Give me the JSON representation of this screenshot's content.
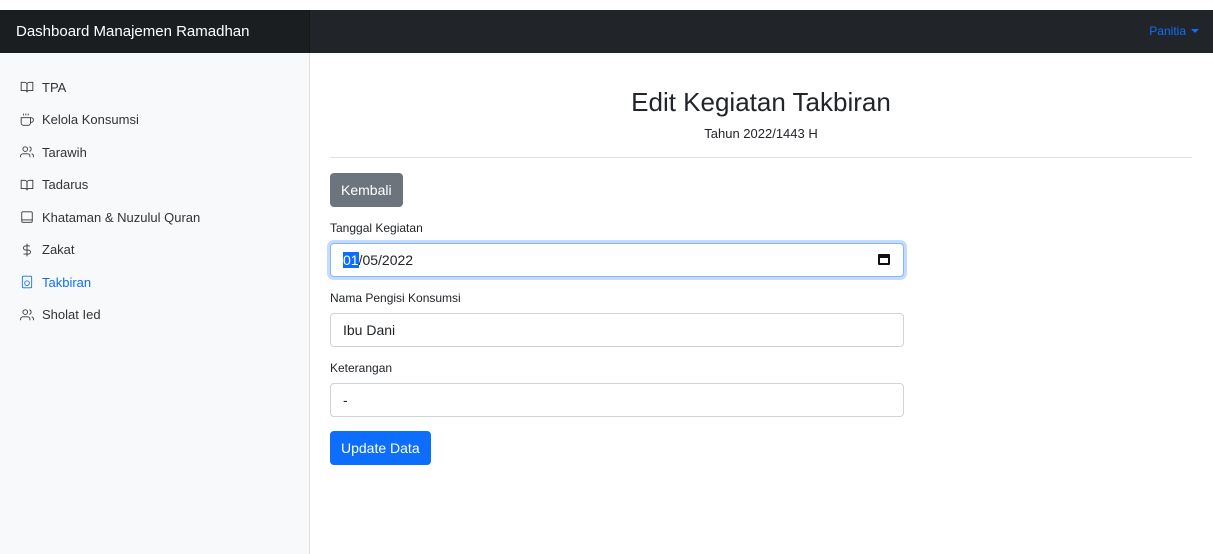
{
  "header": {
    "brand": "Dashboard Manajemen Ramadhan",
    "user_menu_label": "Panitia"
  },
  "sidebar": {
    "items": [
      {
        "label": "TPA",
        "icon": "book-open-icon",
        "active": false
      },
      {
        "label": "Kelola Konsumsi",
        "icon": "coffee-icon",
        "active": false
      },
      {
        "label": "Tarawih",
        "icon": "users-icon",
        "active": false
      },
      {
        "label": "Tadarus",
        "icon": "book-open-icon",
        "active": false
      },
      {
        "label": "Khataman & Nuzulul Quran",
        "icon": "square-icon",
        "active": false
      },
      {
        "label": "Zakat",
        "icon": "dollar-sign-icon",
        "active": false
      },
      {
        "label": "Takbiran",
        "icon": "speaker-icon",
        "active": true
      },
      {
        "label": "Sholat Ied",
        "icon": "users-icon",
        "active": false
      }
    ]
  },
  "main": {
    "title": "Edit Kegiatan Takbiran",
    "subtitle": "Tahun 2022/1443 H",
    "back_button": "Kembali",
    "fields": {
      "tanggal": {
        "label": "Tanggal Kegiatan",
        "value_selected": "01",
        "value_rest": "/05/2022"
      },
      "nama": {
        "label": "Nama Pengisi Konsumsi",
        "value": "Ibu Dani"
      },
      "keterangan": {
        "label": "Keterangan",
        "value": "-"
      }
    },
    "submit_button": "Update Data"
  },
  "colors": {
    "accent": "#0d6efd",
    "topbar": "#212529",
    "sidebar_bg": "#f8f9fa",
    "secondary_button": "#6c757d"
  }
}
